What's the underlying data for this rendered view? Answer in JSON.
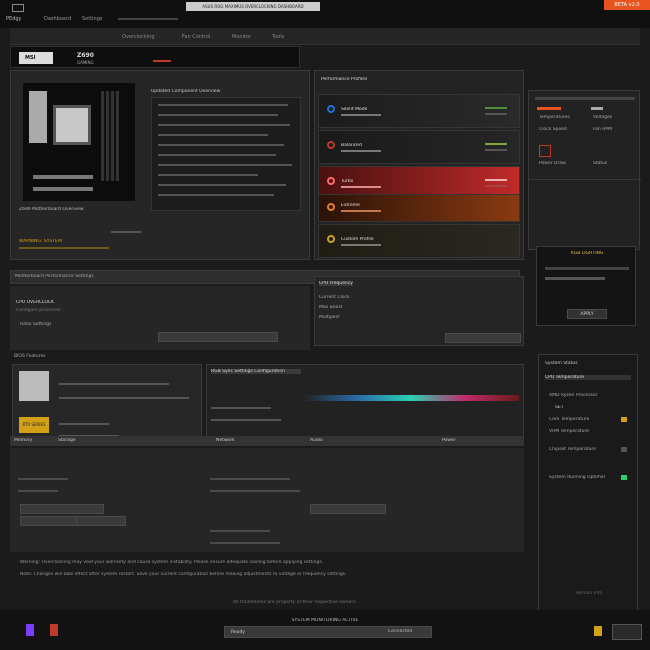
{
  "titlebar": {
    "app_label": "PEdgy",
    "tabs": [
      "Dashboard",
      "Settings"
    ],
    "window_title": "ASUS ROG MAXIMUS OVERCLOCKING DASHBOARD",
    "tag": "BETA v2.0"
  },
  "nav": {
    "brand": "MSI",
    "model": "Z690",
    "model_sub": "GAMING",
    "items": [
      "Overclocking",
      "Fan Control",
      "Monitor",
      "Tools"
    ]
  },
  "overview": {
    "heading": "Updated Component Overview",
    "board_caption": "Z690 Motherboard Overview",
    "warn_label": "WARNING: SYSTEM",
    "spec_rows": 10
  },
  "profiles": {
    "heading": "Performance Profiles",
    "cards": [
      {
        "name": "Silent Mode",
        "accent": "#1e6fd8"
      },
      {
        "name": "Balanced",
        "accent": "#c0392b"
      },
      {
        "name": "Turbo",
        "accent": "#d64545"
      },
      {
        "name": "Extreme",
        "accent": "#e67e22"
      },
      {
        "name": "Custom Profile",
        "accent": "#c9a227"
      }
    ]
  },
  "sidebar_top": {
    "items": [
      "Temperatures",
      "Voltages",
      "Clock Speed",
      "Fan RPM",
      "Power Draw",
      "Status"
    ]
  },
  "status_box": {
    "title": "RGB LIGHTING",
    "button": "APPLY"
  },
  "middle_bar": {
    "label": "Motherboard Performance Settings"
  },
  "overclock": {
    "heading": "CPU OVERCLOCK",
    "sub": "Configure processor",
    "field_label": "Ratio Settings"
  },
  "stats": {
    "title": "CPU Frequency Monitor",
    "rows": [
      "Current Clock",
      "Max Boost",
      "Multiplier"
    ]
  },
  "section2": {
    "label": "BIOS Features",
    "gpu_label": "RTX SERIES",
    "rgb_title": "RGB Sync Settings Configuration",
    "bottom_tabs": [
      "Memory",
      "Storage",
      "Network",
      "Audio",
      "Power"
    ]
  },
  "right_panel": {
    "title": "System Status",
    "header_badge": "CPU Temperature",
    "subtitle": "AMD Ryzen Processor",
    "label": "SET",
    "items": [
      "Core Temperature",
      "VRM Temperature",
      "Chipset Temperature"
    ],
    "footer": "System Running Optimal",
    "version_label": "Version Info"
  },
  "footer": {
    "line1": "Warning: Overclocking may void your warranty and cause system instability. Please ensure adequate cooling before applying settings.",
    "line2": "Note: Changes will take effect after system restart. Save your current configuration before making adjustments to voltage or frequency settings.",
    "copyright": "All trademarks are property of their respective owners.",
    "status_bar": "SYSTEM MONITORING ACTIVE",
    "status_left": "Ready",
    "status_right": "Connected"
  },
  "colors": {
    "accent_orange": "#e8541f",
    "accent_red": "#c0392b",
    "accent_green": "#2ecc71",
    "accent_yellow": "#d4a017",
    "background": "#1b1b1b"
  }
}
